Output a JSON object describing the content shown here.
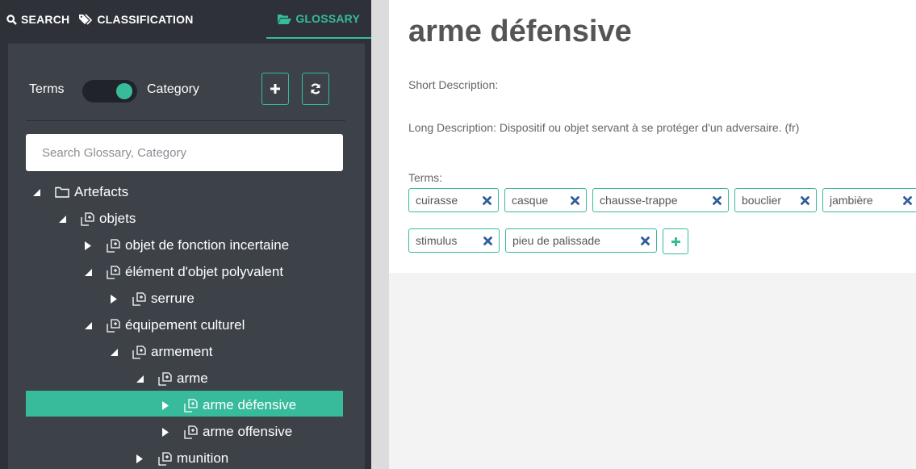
{
  "nav": {
    "search_label": "SEARCH",
    "classification_label": "CLASSIFICATION",
    "glossary_label": "GLOSSARY"
  },
  "panel": {
    "terms_label": "Terms",
    "category_label": "Category",
    "search_placeholder": "Search Glossary, Category"
  },
  "tree": [
    {
      "label": "Artefacts",
      "state": "expanded",
      "icon": "folder-icon"
    },
    {
      "label": "objets",
      "state": "expanded",
      "icon": "category-icon"
    },
    {
      "label": "objet de fonction incertaine",
      "state": "collapsed",
      "icon": "category-icon"
    },
    {
      "label": "élément d'objet polyvalent",
      "state": "expanded",
      "icon": "category-icon"
    },
    {
      "label": "serrure",
      "state": "collapsed",
      "icon": "category-icon"
    },
    {
      "label": "équipement culturel",
      "state": "expanded",
      "icon": "category-icon"
    },
    {
      "label": "armement",
      "state": "expanded",
      "icon": "category-icon"
    },
    {
      "label": "arme",
      "state": "expanded",
      "icon": "category-icon"
    },
    {
      "label": "arme défensive",
      "state": "collapsed",
      "icon": "category-icon",
      "selected": true
    },
    {
      "label": "arme offensive",
      "state": "collapsed",
      "icon": "category-icon"
    },
    {
      "label": "munition",
      "state": "collapsed",
      "icon": "category-icon"
    }
  ],
  "detail": {
    "title": "arme défensive",
    "short_description_label": "Short Description:",
    "long_description": "Long Description: Dispositif ou objet servant à se protéger d'un adversaire. (fr)",
    "terms_label": "Terms:",
    "terms": [
      "cuirasse",
      "casque",
      "chausse-trappe",
      "bouclier",
      "jambière",
      "stimulus",
      "pieu de palissade"
    ]
  },
  "colors": {
    "accent": "#37bb9b",
    "sidebar": "#2e3238",
    "tag_remove": "#2f5f99"
  }
}
